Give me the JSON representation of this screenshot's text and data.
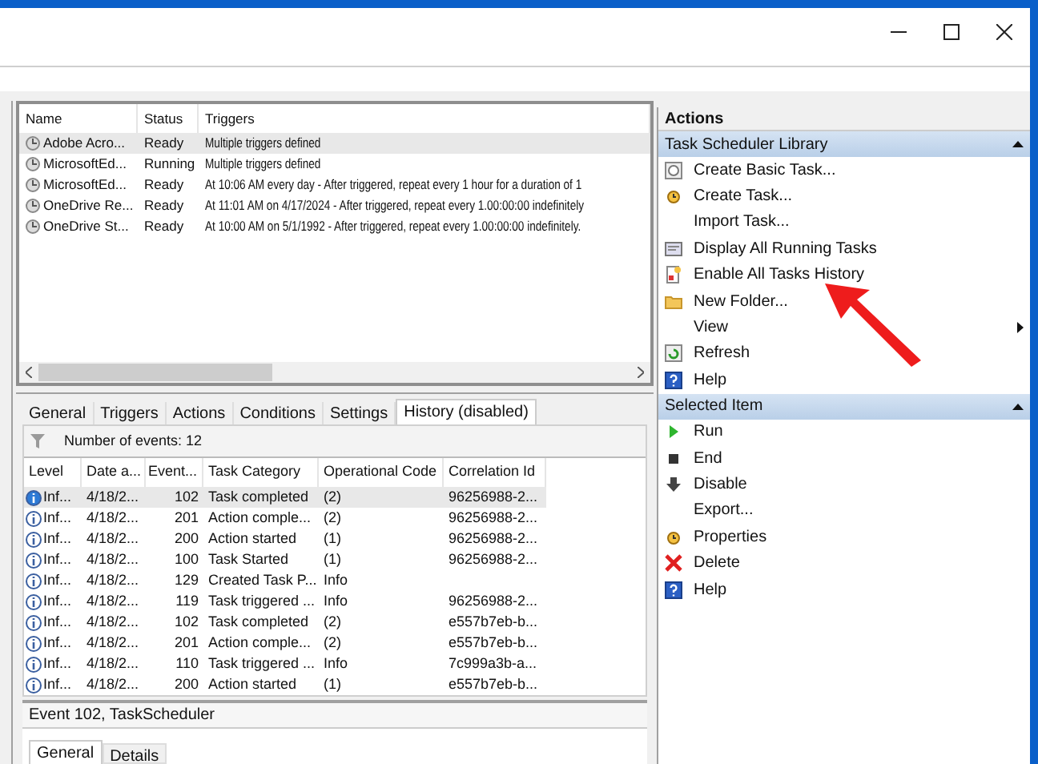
{
  "tasks": {
    "columns": [
      "Name",
      "Status",
      "Triggers"
    ],
    "rows": [
      {
        "name": "Adobe Acro...",
        "status": "Ready",
        "triggers": "Multiple triggers defined",
        "selected": true
      },
      {
        "name": "MicrosoftEd...",
        "status": "Running",
        "triggers": "Multiple triggers defined",
        "selected": false
      },
      {
        "name": "MicrosoftEd...",
        "status": "Ready",
        "triggers": "At 10:06 AM every day - After triggered, repeat every 1 hour for a duration of 1",
        "selected": false
      },
      {
        "name": "OneDrive Re...",
        "status": "Ready",
        "triggers": "At 11:01 AM on 4/17/2024 - After triggered, repeat every 1.00:00:00 indefinitely",
        "selected": false
      },
      {
        "name": "OneDrive St...",
        "status": "Ready",
        "triggers": "At 10:00 AM on 5/1/1992 - After triggered, repeat every 1.00:00:00 indefinitely.",
        "selected": false
      }
    ]
  },
  "tabs": [
    {
      "label": "General",
      "selected": false
    },
    {
      "label": "Triggers",
      "selected": false
    },
    {
      "label": "Actions",
      "selected": false
    },
    {
      "label": "Conditions",
      "selected": false
    },
    {
      "label": "Settings",
      "selected": false
    },
    {
      "label": "History (disabled)",
      "selected": true
    }
  ],
  "history": {
    "count_label": "Number of events: 12",
    "columns": [
      "Level",
      "Date a...",
      "Event...",
      "Task Category",
      "Operational Code",
      "Correlation Id"
    ],
    "rows": [
      {
        "cells": [
          "Inf...",
          "4/18/2...",
          "102",
          "Task completed",
          "(2)",
          "96256988-2..."
        ],
        "selected": true
      },
      {
        "cells": [
          "Inf...",
          "4/18/2...",
          "201",
          "Action comple...",
          "(2)",
          "96256988-2..."
        ],
        "selected": false
      },
      {
        "cells": [
          "Inf...",
          "4/18/2...",
          "200",
          "Action started",
          "(1)",
          "96256988-2..."
        ],
        "selected": false
      },
      {
        "cells": [
          "Inf...",
          "4/18/2...",
          "100",
          "Task Started",
          "(1)",
          "96256988-2..."
        ],
        "selected": false
      },
      {
        "cells": [
          "Inf...",
          "4/18/2...",
          "129",
          "Created Task P...",
          "Info",
          ""
        ],
        "selected": false
      },
      {
        "cells": [
          "Inf...",
          "4/18/2...",
          "119",
          "Task triggered ...",
          "Info",
          "96256988-2..."
        ],
        "selected": false
      },
      {
        "cells": [
          "Inf...",
          "4/18/2...",
          "102",
          "Task completed",
          "(2)",
          "e557b7eb-b..."
        ],
        "selected": false
      },
      {
        "cells": [
          "Inf...",
          "4/18/2...",
          "201",
          "Action comple...",
          "(2)",
          "e557b7eb-b..."
        ],
        "selected": false
      },
      {
        "cells": [
          "Inf...",
          "4/18/2...",
          "110",
          "Task triggered ...",
          "Info",
          "7c999a3b-a..."
        ],
        "selected": false
      },
      {
        "cells": [
          "Inf...",
          "4/18/2...",
          "200",
          "Action started",
          "(1)",
          "e557b7eb-b..."
        ],
        "selected": false
      }
    ]
  },
  "event": {
    "title": "Event 102, TaskScheduler",
    "tabs": [
      {
        "label": "General",
        "selected": true
      },
      {
        "label": "Details",
        "selected": false
      }
    ]
  },
  "actions": {
    "title": "Actions",
    "sections": [
      {
        "title": "Task Scheduler Library",
        "expanded": true,
        "items": [
          {
            "label": "Create Basic Task...",
            "kind": "wizard"
          },
          {
            "label": "Create Task...",
            "kind": "clock"
          },
          {
            "label": "Import Task...",
            "kind": "none"
          },
          {
            "label": "Display All Running Tasks",
            "kind": "monitor"
          },
          {
            "label": "Enable All Tasks History",
            "kind": "history"
          },
          {
            "label": "New Folder...",
            "kind": "folder"
          },
          {
            "label": "View",
            "kind": "none",
            "submenu": true
          },
          {
            "label": "Refresh",
            "kind": "refresh"
          },
          {
            "label": "Help",
            "kind": "help"
          }
        ]
      },
      {
        "title": "Selected Item",
        "expanded": true,
        "items": [
          {
            "label": "Run",
            "kind": "run"
          },
          {
            "label": "End",
            "kind": "end"
          },
          {
            "label": "Disable",
            "kind": "disable"
          },
          {
            "label": "Export...",
            "kind": "none"
          },
          {
            "label": "Properties",
            "kind": "clock"
          },
          {
            "label": "Delete",
            "kind": "delete"
          },
          {
            "label": "Help",
            "kind": "help"
          }
        ]
      }
    ]
  }
}
